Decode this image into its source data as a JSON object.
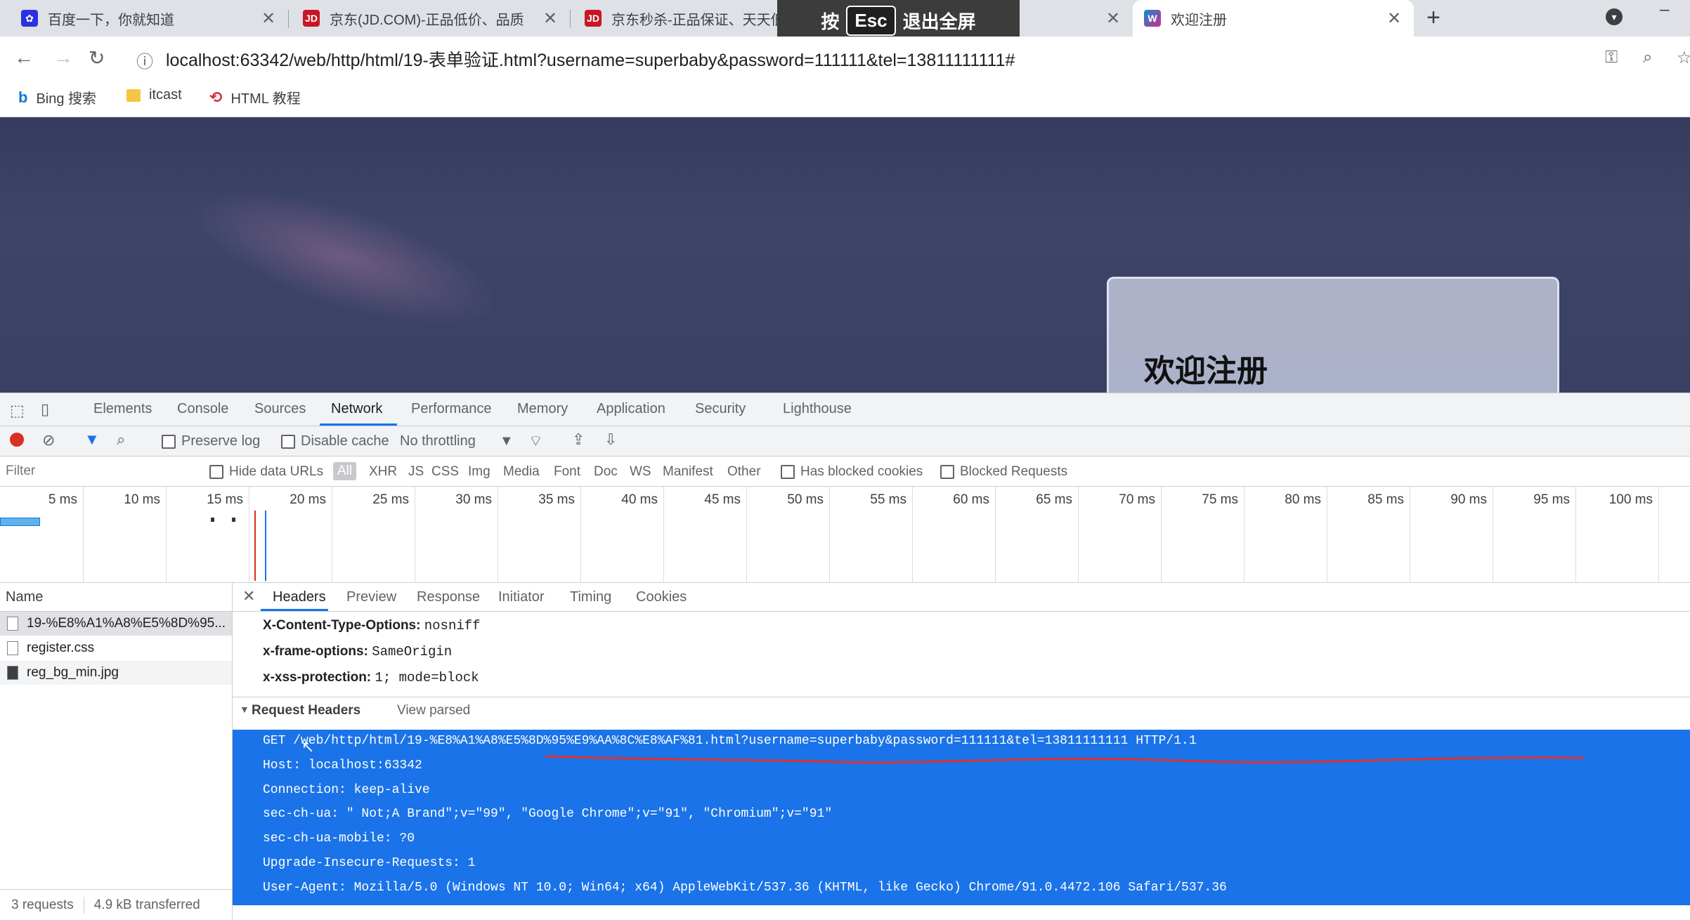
{
  "tabs": [
    {
      "title": "百度一下，你就知道",
      "favicon": "baidu-paw-icon"
    },
    {
      "title": "京东(JD.COM)-正品低价、品质",
      "favicon": "jd-logo-icon"
    },
    {
      "title": "京东秒杀-正品保证、天天低价",
      "favicon": "jd-logo-icon"
    },
    {
      "title": "欢迎注册",
      "favicon": "webstorm-icon"
    }
  ],
  "fullscreen_banner": {
    "press": "按",
    "key": "Esc",
    "action": "退出全屏"
  },
  "address_bar": {
    "url": "localhost:63342/web/http/html/19-表单验证.html?username=superbaby&password=111111&tel=13811111111#"
  },
  "bookmarks": [
    {
      "label": "Bing 搜索",
      "icon": "bing-icon"
    },
    {
      "label": "itcast",
      "icon": "folder-icon"
    },
    {
      "label": "HTML 教程",
      "icon": "html-tutorial-icon"
    }
  ],
  "page": {
    "register_title": "欢迎注册"
  },
  "devtools": {
    "tabs": [
      "Elements",
      "Console",
      "Sources",
      "Network",
      "Performance",
      "Memory",
      "Application",
      "Security",
      "Lighthouse"
    ],
    "active_tab": "Network",
    "network_toolbar": {
      "preserve_log": "Preserve log",
      "disable_cache": "Disable cache",
      "throttling": "No throttling"
    },
    "filter": {
      "placeholder": "Filter",
      "hide_data_urls": "Hide data URLs",
      "types": [
        "All",
        "XHR",
        "JS",
        "CSS",
        "Img",
        "Media",
        "Font",
        "Doc",
        "WS",
        "Manifest",
        "Other"
      ],
      "has_blocked_cookies": "Has blocked cookies",
      "blocked_requests": "Blocked Requests"
    },
    "timeline_ticks": [
      "5 ms",
      "10 ms",
      "15 ms",
      "20 ms",
      "25 ms",
      "30 ms",
      "35 ms",
      "40 ms",
      "45 ms",
      "50 ms",
      "55 ms",
      "60 ms",
      "65 ms",
      "70 ms",
      "75 ms",
      "80 ms",
      "85 ms",
      "90 ms",
      "95 ms",
      "100 ms"
    ],
    "name_header": "Name",
    "requests": [
      "19-%E8%A1%A8%E5%8D%95...",
      "register.css",
      "reg_bg_min.jpg"
    ],
    "status": {
      "requests": "3 requests",
      "transferred": "4.9 kB transferred"
    },
    "detail_tabs": [
      "Headers",
      "Preview",
      "Response",
      "Initiator",
      "Timing",
      "Cookies"
    ],
    "response_headers": [
      {
        "name": "X-Content-Type-Options:",
        "value": "nosniff"
      },
      {
        "name": "x-frame-options:",
        "value": "SameOrigin"
      },
      {
        "name": "x-xss-protection:",
        "value": "1; mode=block"
      }
    ],
    "request_headers_title": "Request Headers",
    "view_parsed": "View parsed",
    "raw_request_lines": [
      "GET /web/http/html/19-%E8%A1%A8%E5%8D%95%E9%AA%8C%E8%AF%81.html?username=superbaby&password=111111&tel=13811111111 HTTP/1.1",
      "Host: localhost:63342",
      "Connection: keep-alive",
      "sec-ch-ua: \" Not;A Brand\";v=\"99\", \"Google Chrome\";v=\"91\", \"Chromium\";v=\"91\"",
      "sec-ch-ua-mobile: ?0",
      "Upgrade-Insecure-Requests: 1",
      "User-Agent: Mozilla/5.0 (Windows NT 10.0; Win64; x64) AppleWebKit/537.36 (KHTML, like Gecko) Chrome/91.0.4472.106 Safari/537.36"
    ]
  },
  "colors": {
    "accent": "#1a73e8",
    "record": "#d93025",
    "annotation": "#e0302a"
  }
}
